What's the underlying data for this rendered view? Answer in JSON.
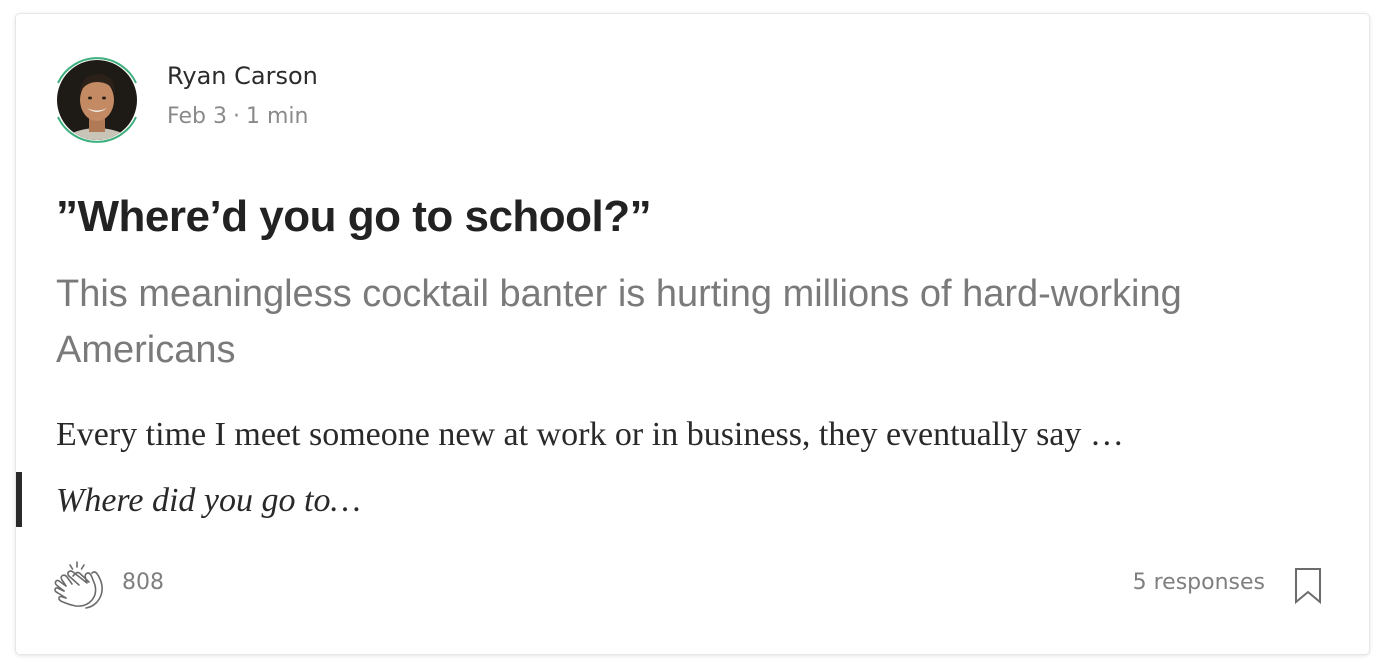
{
  "author": {
    "name": "Ryan Carson",
    "date": "Feb 3",
    "separator": "·",
    "read_time": "1 min"
  },
  "story": {
    "title": "”Where’d you go to school?”",
    "subtitle": "This meaningless cocktail banter is hurting millions of hard-working Americans",
    "excerpt": "Every time I meet someone new at work or in business, they eventually say …",
    "pull_quote": "Where did you go to…"
  },
  "footer": {
    "claps": "808",
    "responses": "5 responses"
  },
  "icons": {
    "clap": "clap-icon",
    "bookmark": "bookmark-icon"
  },
  "colors": {
    "accent_ring": "#3eaf7c",
    "title": "#222222",
    "subtitle": "#7a7a7a",
    "meta": "#8a8a8a"
  }
}
